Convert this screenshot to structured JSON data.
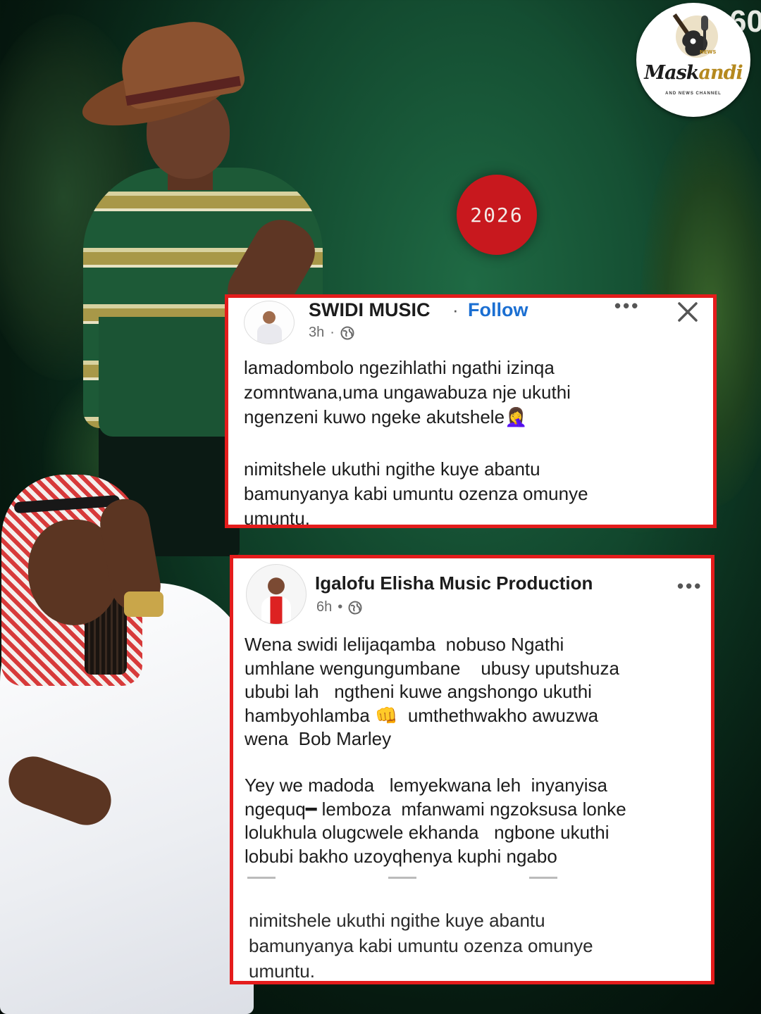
{
  "corner_text": "60",
  "logo": {
    "brand_main": "Mask",
    "brand_accent": "andi",
    "sub": "AND NEWS CHANNEL",
    "mic_label": "NEWS"
  },
  "year_badge": "2026",
  "post1": {
    "author": "SWIDI MUSIC",
    "separator": "·",
    "follow": "Follow",
    "time": "3h",
    "dot": "·",
    "more": "•••",
    "text1": "lamadombolo ngezihlathi ngathi izinqa\nzomntwana,uma ungawabuza nje ukuthi\nngenzeni kuwo ngeke akutshele🤦‍♀️",
    "text2": "nimitshele ukuthi ngithe kuye abantu\nbamunyanya kabi umuntu ozenza omunye\numuntu."
  },
  "post2": {
    "author": "Igalofu Elisha Music Production",
    "time": "6h",
    "dot": "•",
    "more": "•••",
    "text1": "Wena swidi lelijaqamba  nobuso Ngathi\numhlane wengungumbane    ubusy uputshuza\nububi lah   ngtheni kuwe angshongo ukuthi\nhambyohlamba 👊  umthethwakho awuzwa\nwena  Bob Marley",
    "text2": "Yey we madoda   lemyekwana leh  inyanyisa\nngequq━ lemboza  mfanwami ngzoksusa lonke\nlolukhula olugcwele ekhanda   ngbone ukuthi\nlobubi bakho uzoyqhenya kuphi ngabo",
    "text3": "nimitshele ukuthi ngithe kuye abantu\nbamunyanya kabi umuntu ozenza omunye\numuntu."
  },
  "colors": {
    "post_border": "#e41c1c",
    "follow": "#1b6fd2",
    "badge": "#c8181e",
    "background": "#10422a"
  }
}
